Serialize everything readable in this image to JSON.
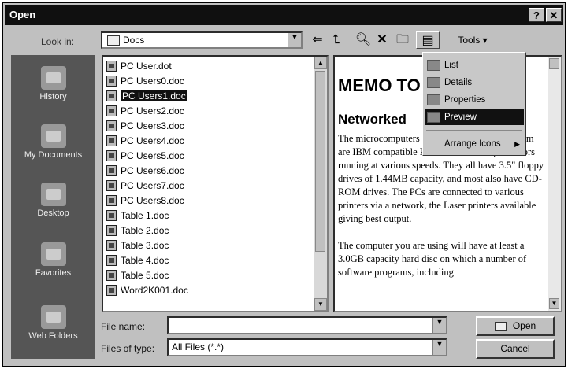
{
  "window": {
    "title": "Open",
    "help_label": "?",
    "close_label": "✕"
  },
  "toolbar": {
    "look_in_label": "Look in:",
    "look_in_value": "Docs",
    "tools_label": "Tools ▾"
  },
  "places": [
    {
      "label": "History",
      "icon": "history-icon"
    },
    {
      "label": "My Documents",
      "icon": "my-documents-icon"
    },
    {
      "label": "Desktop",
      "icon": "desktop-icon"
    },
    {
      "label": "Favorites",
      "icon": "favorites-icon"
    },
    {
      "label": "Web Folders",
      "icon": "web-folders-icon"
    }
  ],
  "files": [
    "PC User.dot",
    "PC Users0.doc",
    "PC Users1.doc",
    "PC Users2.doc",
    "PC Users3.doc",
    "PC Users4.doc",
    "PC Users5.doc",
    "PC Users6.doc",
    "PC Users7.doc",
    "PC Users8.doc",
    "Table 1.doc",
    "Table 2.doc",
    "Table 3.doc",
    "Table 4.doc",
    "Table 5.doc",
    "Word2K001.doc"
  ],
  "selected_file": "PC Users1.doc",
  "views_menu": {
    "items": [
      "List",
      "Details",
      "Properties",
      "Preview",
      "Arrange Icons"
    ],
    "highlighted": "Preview"
  },
  "preview": {
    "heading": "MEMO TO USERS",
    "subheading": "Networked",
    "paragraph1": "The microcomputers in the Data Processing room are IBM compatible PCs with Pentium processors running at various speeds. They all have 3.5\" floppy drives of 1.44MB capacity, and most also have CD-ROM drives. The PCs are connected to various printers via a network, the Laser printers available giving best output.",
    "paragraph2": "The computer you are using will have at least a 3.0GB capacity hard disc on which a number of software programs, including"
  },
  "bottom": {
    "file_name_label": "File name:",
    "file_name_value": "",
    "file_type_label": "Files of type:",
    "file_type_value": "All Files (*.*)",
    "open_label": "Open",
    "cancel_label": "Cancel"
  }
}
